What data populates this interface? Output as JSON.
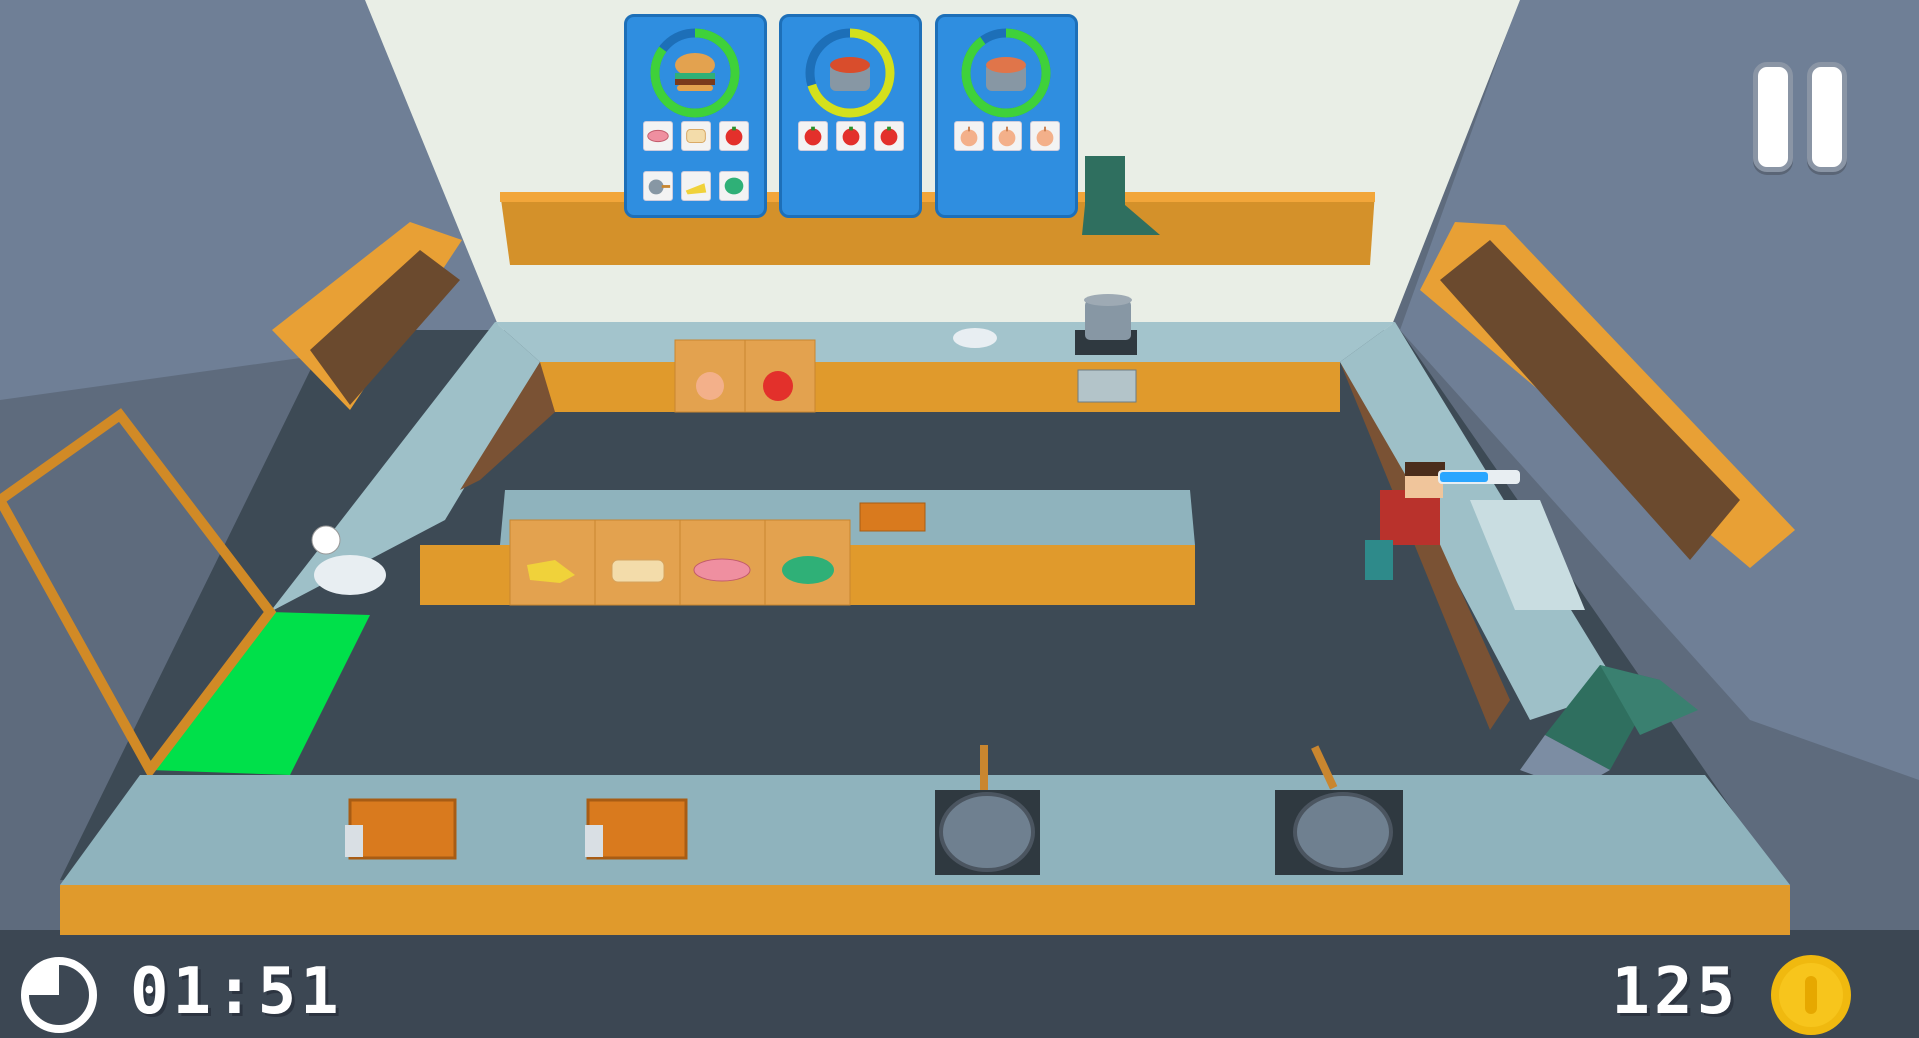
{
  "hud": {
    "timer": "01:51",
    "coins": "125",
    "pause_icon": "pause-icon",
    "timer_icon": "clock-icon",
    "coin_icon": "gold-coin-icon"
  },
  "orders": [
    {
      "dish": "burger",
      "ring_color": "#3fd13a",
      "progress": 0.85,
      "ingredients": [
        "meat",
        "bread",
        "tomato",
        "frying-pan",
        "cheese",
        "lettuce"
      ]
    },
    {
      "dish": "tomato-soup",
      "ring_color": "#d4e01c",
      "progress": 0.7,
      "ingredients": [
        "tomato",
        "tomato",
        "tomato"
      ]
    },
    {
      "dish": "onion-soup",
      "ring_color": "#3fd13a",
      "progress": 0.9,
      "ingredients": [
        "onion",
        "onion",
        "onion"
      ]
    }
  ],
  "colors": {
    "wall": "#e9eee6",
    "floor": "#3d4a55",
    "counter_top": "#8fb3bd",
    "counter_front": "#e09a2c",
    "serving_window": "#00e04a",
    "progress_bar": "#2aa6ff"
  },
  "stations": {
    "crates": [
      "onion",
      "tomato",
      "cheese",
      "bread",
      "meat",
      "lettuce"
    ],
    "boards": [
      "chopping-board",
      "chopping-board",
      "chopping-board"
    ],
    "pans": [
      "frying-pan",
      "frying-pan"
    ],
    "stove_pot": "cooking-pot",
    "trash": "trash-bin",
    "sink": "sink"
  }
}
